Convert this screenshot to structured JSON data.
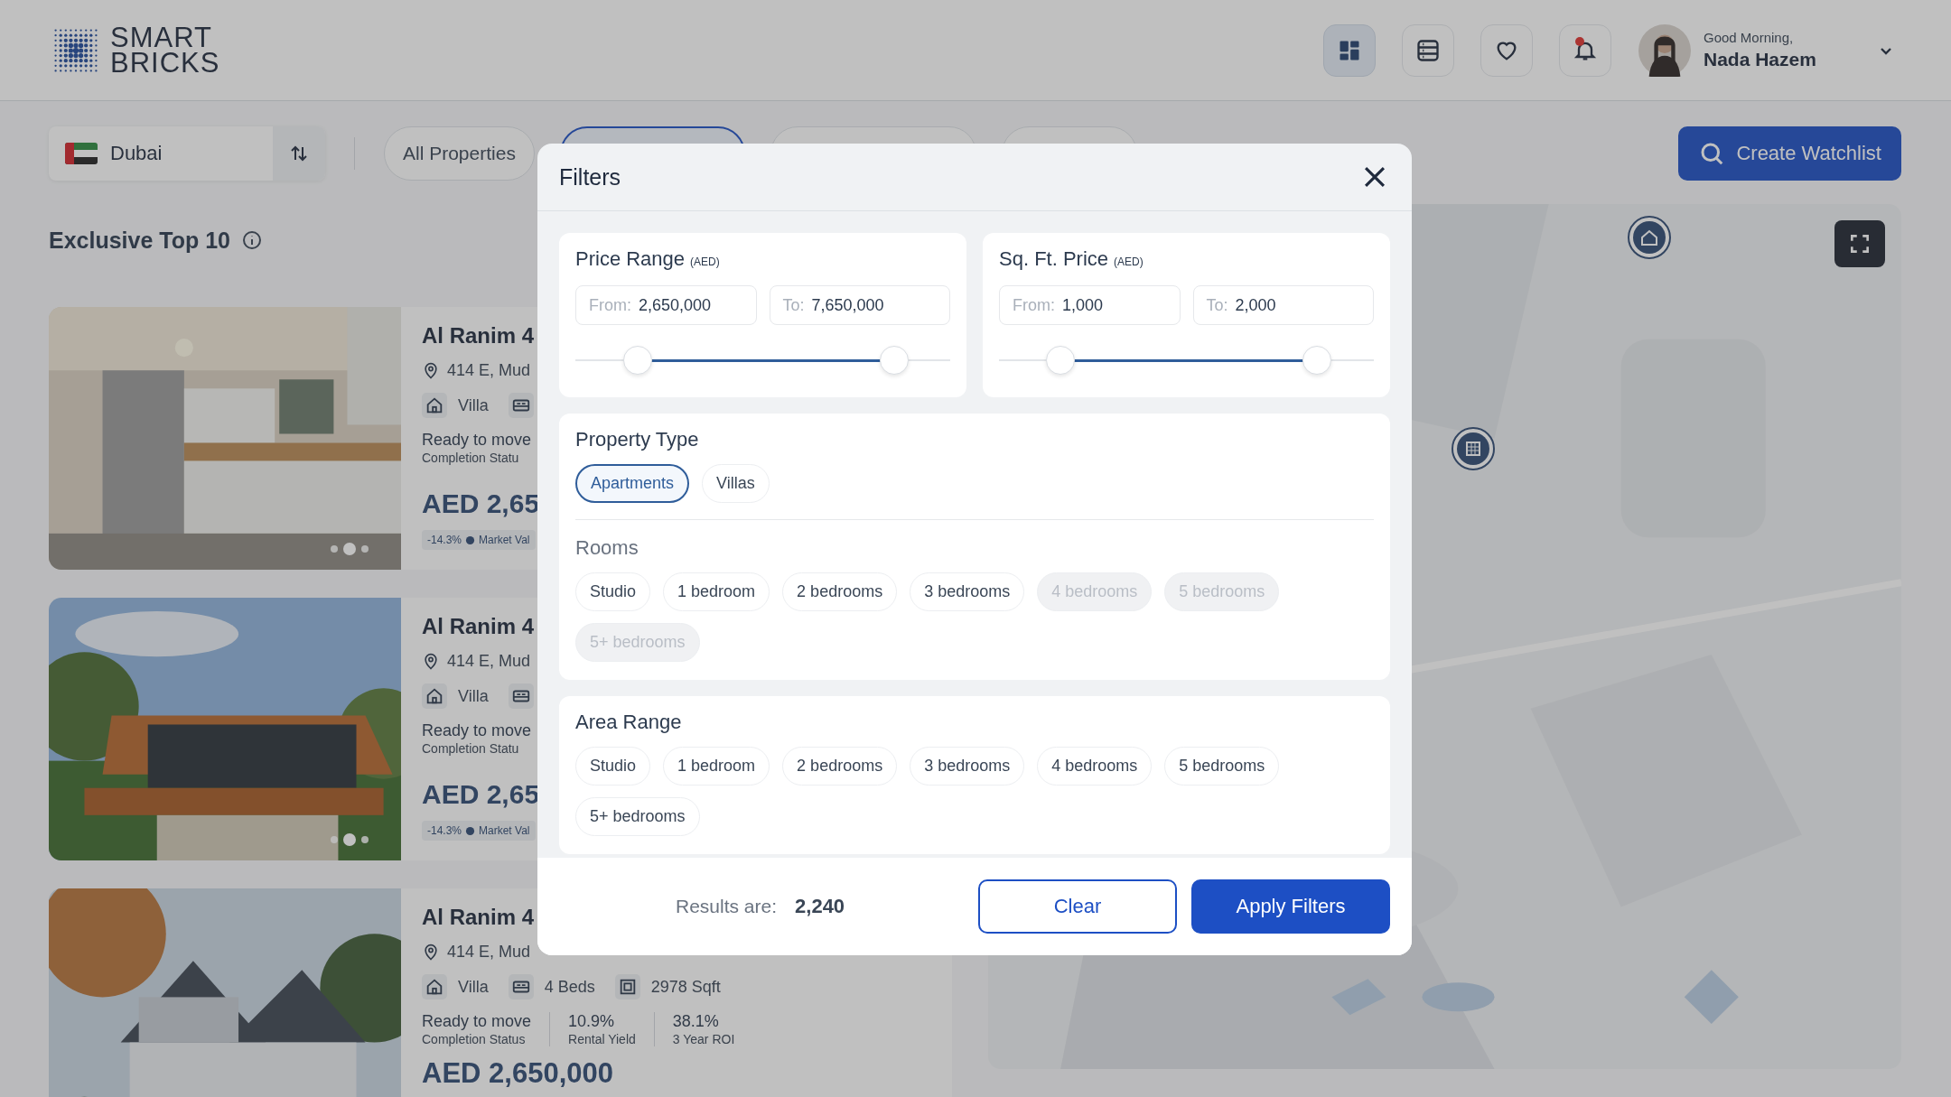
{
  "header": {
    "logo": [
      "SMART",
      "BRICKS"
    ],
    "nav_icons": [
      {
        "kind": "grid",
        "selected": true,
        "badge": false
      },
      {
        "kind": "list",
        "selected": false,
        "badge": false
      },
      {
        "kind": "heart",
        "selected": false,
        "badge": false
      },
      {
        "kind": "bell",
        "selected": false,
        "badge": true
      }
    ],
    "greeting": "Good Morning,",
    "user_name": "Nada Hazem"
  },
  "location": {
    "city": "Dubai"
  },
  "tabs": [
    {
      "label": "All Properties",
      "selected": false
    },
    {
      "selected": true
    },
    {
      "selected": false
    },
    {
      "selected": false
    }
  ],
  "watchlist_button": "Create Watchlist",
  "section_title": "Exclusive Top 10",
  "listings": [
    {
      "title": "Al Ranim 4",
      "address": "414 E, Mud",
      "features": [
        {
          "kind": "type",
          "text": "Villa"
        },
        {
          "kind": "beds"
        }
      ],
      "stats": [
        {
          "value": "Ready to move",
          "label": "Completion Statu"
        }
      ],
      "price": "AED 2,65",
      "change": "-14.3%",
      "change_label": "Market Val",
      "dots": [
        {
          "selected": false
        },
        {
          "selected": true
        },
        {
          "selected": false
        }
      ]
    },
    {
      "title": "Al Ranim 4",
      "address": "414 E, Mud",
      "features": [
        {
          "kind": "type",
          "text": "Villa"
        },
        {
          "kind": "beds"
        }
      ],
      "stats": [
        {
          "value": "Ready to move",
          "label": "Completion Statu"
        }
      ],
      "price": "AED 2,65",
      "change": "-14.3%",
      "change_label": "Market Val",
      "dots": [
        {
          "selected": false
        },
        {
          "selected": true
        },
        {
          "selected": false
        }
      ]
    },
    {
      "title": "Al Ranim 4",
      "address": "414 E, Mud",
      "features": [
        {
          "kind": "type",
          "text": "Villa"
        },
        {
          "kind": "beds",
          "text": "4 Beds"
        },
        {
          "kind": "area",
          "text": "2978 Sqft"
        }
      ],
      "stats": [
        {
          "value": "Ready to move",
          "label": "Completion Status"
        },
        {
          "value": "10.9%",
          "label": "Rental Yield"
        },
        {
          "value": "38.1%",
          "label": "3 Year ROI"
        }
      ],
      "price": "AED 2,650,000"
    }
  ],
  "filters": {
    "title": "Filters",
    "ranges": [
      {
        "title": "Price Range",
        "unit": "(AED)",
        "from_label": "From:",
        "from": "2,650,000",
        "to_label": "To:",
        "to": "7,650,000",
        "thumbs": [
          {
            "level": 0.166
          },
          {
            "level": 0.85
          }
        ]
      },
      {
        "title": "Sq. Ft. Price",
        "unit": "(AED)",
        "from_label": "From:",
        "from": "1,000",
        "to_label": "To:",
        "to": "2,000",
        "thumbs": [
          {
            "level": 0.164
          },
          {
            "level": 0.848
          }
        ]
      }
    ],
    "property_type": {
      "title": "Property Type",
      "options": [
        {
          "label": "Apartments",
          "selected": true,
          "disabled": false
        },
        {
          "label": "Villas",
          "selected": false,
          "disabled": false
        }
      ]
    },
    "rooms": {
      "title": "Rooms",
      "options": [
        {
          "label": "Studio",
          "selected": false,
          "disabled": false
        },
        {
          "label": "1 bedroom",
          "selected": false,
          "disabled": false
        },
        {
          "label": "2 bedrooms",
          "selected": false,
          "disabled": false
        },
        {
          "label": "3 bedrooms",
          "selected": false,
          "disabled": false
        },
        {
          "label": "4 bedrooms",
          "selected": false,
          "disabled": true
        },
        {
          "label": "5 bedrooms",
          "selected": false,
          "disabled": true
        },
        {
          "label": "5+ bedrooms",
          "selected": false,
          "disabled": true
        }
      ]
    },
    "area_range": {
      "title": "Area Range",
      "options": [
        {
          "label": "Studio",
          "selected": false,
          "disabled": false
        },
        {
          "label": "1 bedroom",
          "selected": false,
          "disabled": false
        },
        {
          "label": "2 bedrooms",
          "selected": false,
          "disabled": false
        },
        {
          "label": "3 bedrooms",
          "selected": false,
          "disabled": false
        },
        {
          "label": "4 bedrooms",
          "selected": false,
          "disabled": false
        },
        {
          "label": "5 bedrooms",
          "selected": false,
          "disabled": false
        },
        {
          "label": "5+ bedrooms",
          "selected": false,
          "disabled": false
        }
      ]
    },
    "results_label": "Results are:",
    "results_count": "2,240",
    "clear_button": "Clear",
    "apply_button": "Apply Filters"
  }
}
